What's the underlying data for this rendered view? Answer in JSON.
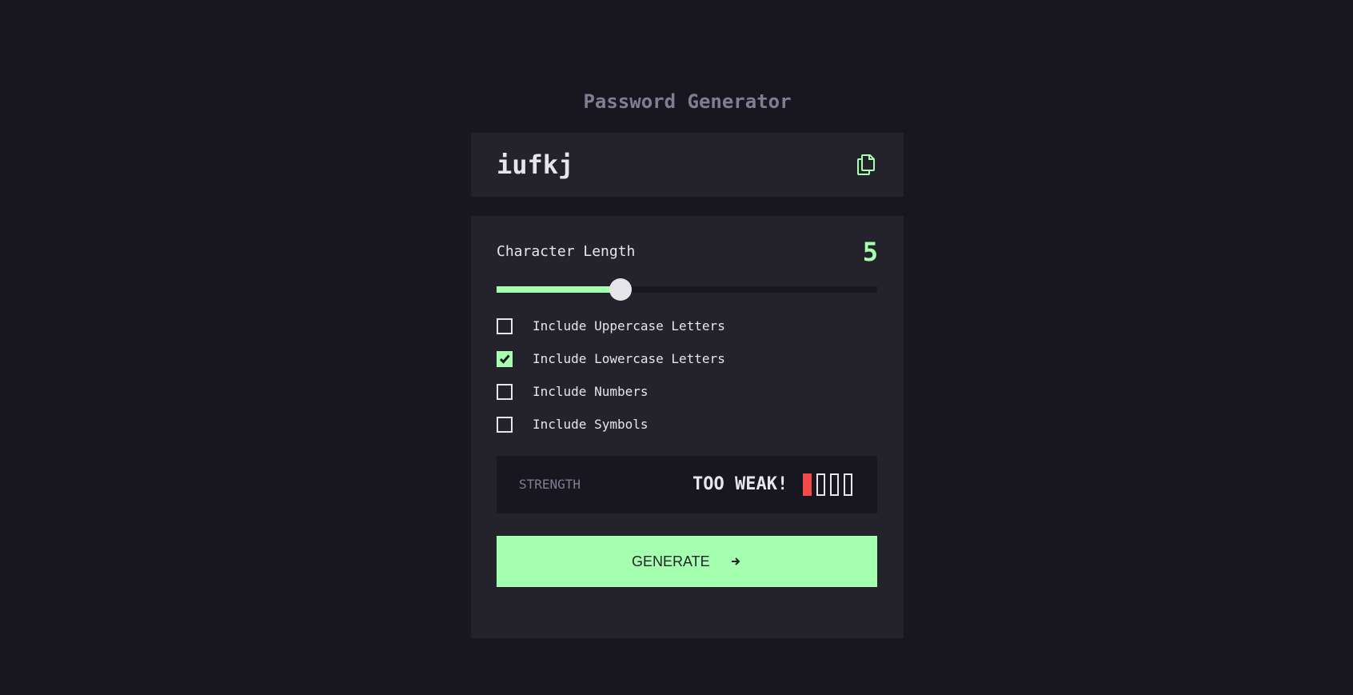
{
  "app": {
    "title": "Password Generator"
  },
  "output": {
    "password": "iufkj",
    "copy_icon": "copy-icon"
  },
  "settings": {
    "length_label": "Character Length",
    "length_value": "5",
    "slider": {
      "min": 0,
      "max": 20,
      "value": 5
    },
    "options": [
      {
        "label": "Include Uppercase Letters",
        "checked": false
      },
      {
        "label": "Include Lowercase Letters",
        "checked": true
      },
      {
        "label": "Include Numbers",
        "checked": false
      },
      {
        "label": "Include Symbols",
        "checked": false
      }
    ],
    "strength": {
      "label": "STRENGTH",
      "rating": "TOO WEAK!",
      "bars_total": 4,
      "bars_filled": 1,
      "filled_color": "#f64a4a"
    },
    "generate": {
      "label": "GENERATE",
      "icon": "arrow-right-icon"
    }
  },
  "colors": {
    "background": "#18171f",
    "panel": "#24232c",
    "accent": "#a4ffaf",
    "text": "#e6e5ea",
    "muted": "#817d92",
    "danger": "#f64a4a"
  }
}
